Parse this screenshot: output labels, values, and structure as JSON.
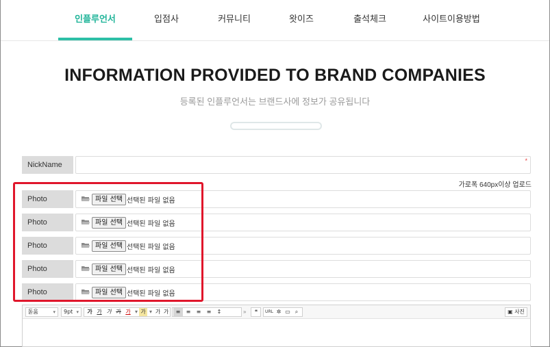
{
  "nav": {
    "tabs": [
      {
        "label": "인플루언서",
        "active": true
      },
      {
        "label": "입점사",
        "active": false
      },
      {
        "label": "커뮤니티",
        "active": false
      },
      {
        "label": "왓이즈",
        "active": false
      },
      {
        "label": "출석체크",
        "active": false
      },
      {
        "label": "사이트이용방법",
        "active": false
      }
    ]
  },
  "hero": {
    "title": "INFORMATION PROVIDED TO BRAND COMPANIES",
    "subtitle": "등록된 인플루언서는 브랜드사에 정보가 공유됩니다"
  },
  "form": {
    "nickname": {
      "label": "NickName",
      "value": "",
      "required_mark": "*"
    },
    "photo_hint": "가로폭 640px이상 업로드",
    "photos": [
      {
        "label": "Photo",
        "button": "파일 선택",
        "status": "선택된 파일 없음"
      },
      {
        "label": "Photo",
        "button": "파일 선택",
        "status": "선택된 파일 없음"
      },
      {
        "label": "Photo",
        "button": "파일 선택",
        "status": "선택된 파일 없음"
      },
      {
        "label": "Photo",
        "button": "파일 선택",
        "status": "선택된 파일 없음"
      },
      {
        "label": "Photo",
        "button": "파일 선택",
        "status": "선택된 파일 없음"
      }
    ]
  },
  "editor": {
    "font_select": "돋움",
    "size_select": "9pt",
    "buttons": {
      "bold": "가",
      "underline": "가",
      "italic": "가",
      "strike": "가",
      "font_color": "가",
      "bg_color": "가",
      "superscript": "가",
      "subscript": "가",
      "more": "»",
      "quote": "❝",
      "url": "URL",
      "photo": "사진"
    }
  },
  "colors": {
    "accent": "#2dbfa6",
    "highlight_box": "#e0162b"
  }
}
